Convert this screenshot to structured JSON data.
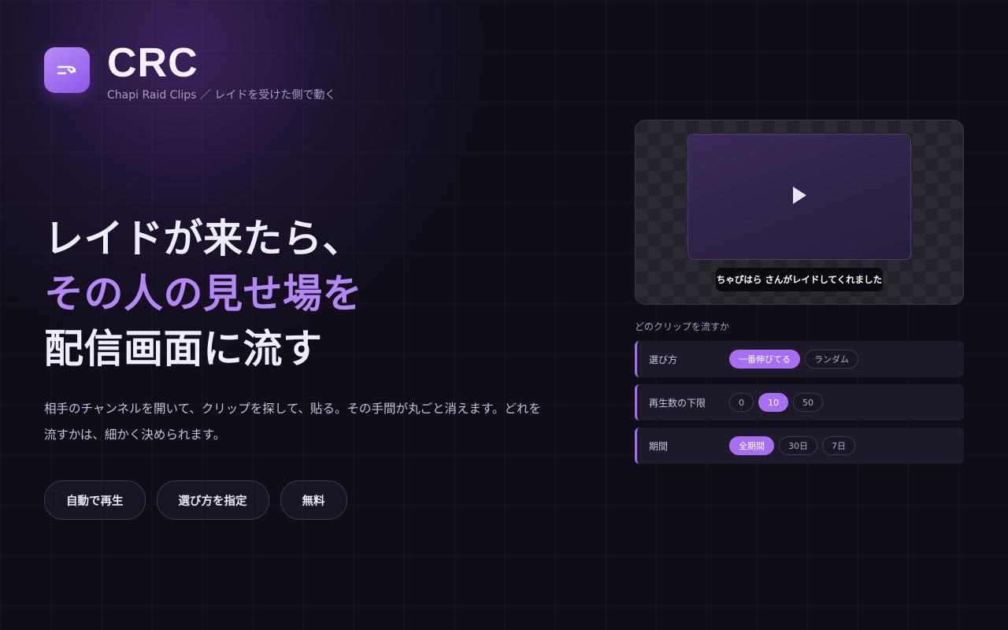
{
  "brand": {
    "name": "CRC",
    "tagline": "Chapi Raid Clips ／ レイドを受けた側で動く",
    "logo_icon": "redirect-arrow-icon",
    "accent_color": "#a66ef0"
  },
  "hero": {
    "line1": "レイドが来たら、",
    "line2": "その人の見せ場を",
    "line3": "配信画面に流す",
    "description": "相手のチャンネルを開いて、クリップを探して、貼る。その手間が丸ごと消えます。どれを流すかは、細かく決められます。"
  },
  "features": [
    {
      "label": "自動で再生"
    },
    {
      "label": "選び方を指定"
    },
    {
      "label": "無料"
    }
  ],
  "preview": {
    "play_icon": "play-icon",
    "toast": "ちゃぴはら さんがレイドしてくれました"
  },
  "settings": {
    "title": "どのクリップを流すか",
    "rows": [
      {
        "label": "選び方",
        "options": [
          {
            "label": "一番伸びてる",
            "selected": true
          },
          {
            "label": "ランダム",
            "selected": false
          }
        ]
      },
      {
        "label": "再生数の下限",
        "options": [
          {
            "label": "0",
            "selected": false
          },
          {
            "label": "10",
            "selected": true
          },
          {
            "label": "50",
            "selected": false
          }
        ]
      },
      {
        "label": "期間",
        "options": [
          {
            "label": "全期間",
            "selected": true
          },
          {
            "label": "30日",
            "selected": false
          },
          {
            "label": "7日",
            "selected": false
          }
        ]
      }
    ]
  }
}
